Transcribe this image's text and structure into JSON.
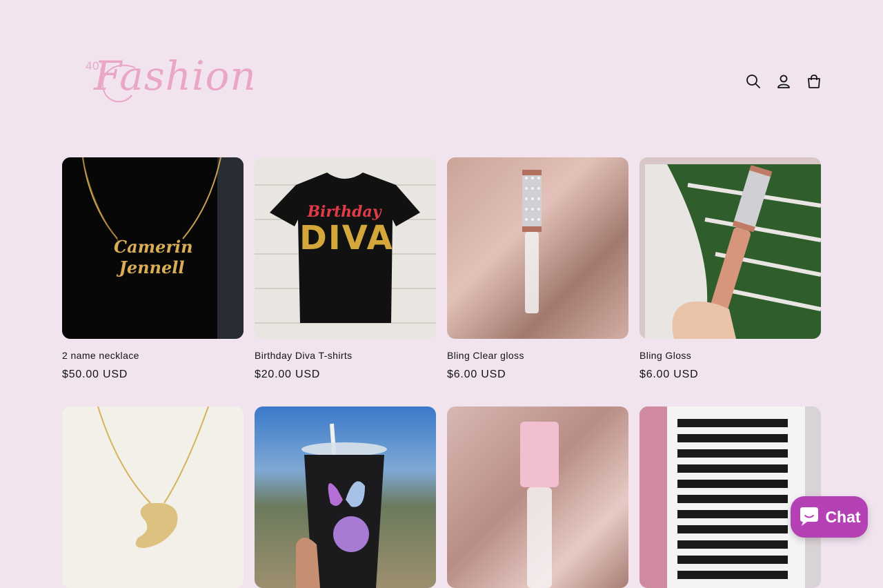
{
  "brand": {
    "number": "401",
    "name": "Fashion",
    "color": "#eaa6c5"
  },
  "header_icons": [
    "search-icon",
    "account-icon",
    "cart-icon"
  ],
  "products": [
    {
      "title": "2 name necklace",
      "price": "$50.00 USD",
      "image": "gold name necklace on black bust",
      "image_text": [
        "Camerin",
        "Jennell"
      ]
    },
    {
      "title": "Birthday Diva T-shirts",
      "price": "$20.00 USD",
      "image": "black t-shirt with Birthday Diva print",
      "image_text": [
        "Birthday",
        "DIVA"
      ]
    },
    {
      "title": "Bling Clear gloss",
      "price": "$6.00 USD",
      "image": "rhinestone cap clear lip gloss on satin"
    },
    {
      "title": "Bling Gloss",
      "price": "$6.00 USD",
      "image": "rhinestone cap nude lip gloss held in hand"
    },
    {
      "image": "gold bubble initial necklace"
    },
    {
      "image": "butterfly tumbler sleeve held outdoors"
    },
    {
      "image": "pink cap lip gloss on satin"
    },
    {
      "image": "tray of lash clusters"
    }
  ],
  "chat": {
    "label": "Chat",
    "color": "#b542b5"
  }
}
